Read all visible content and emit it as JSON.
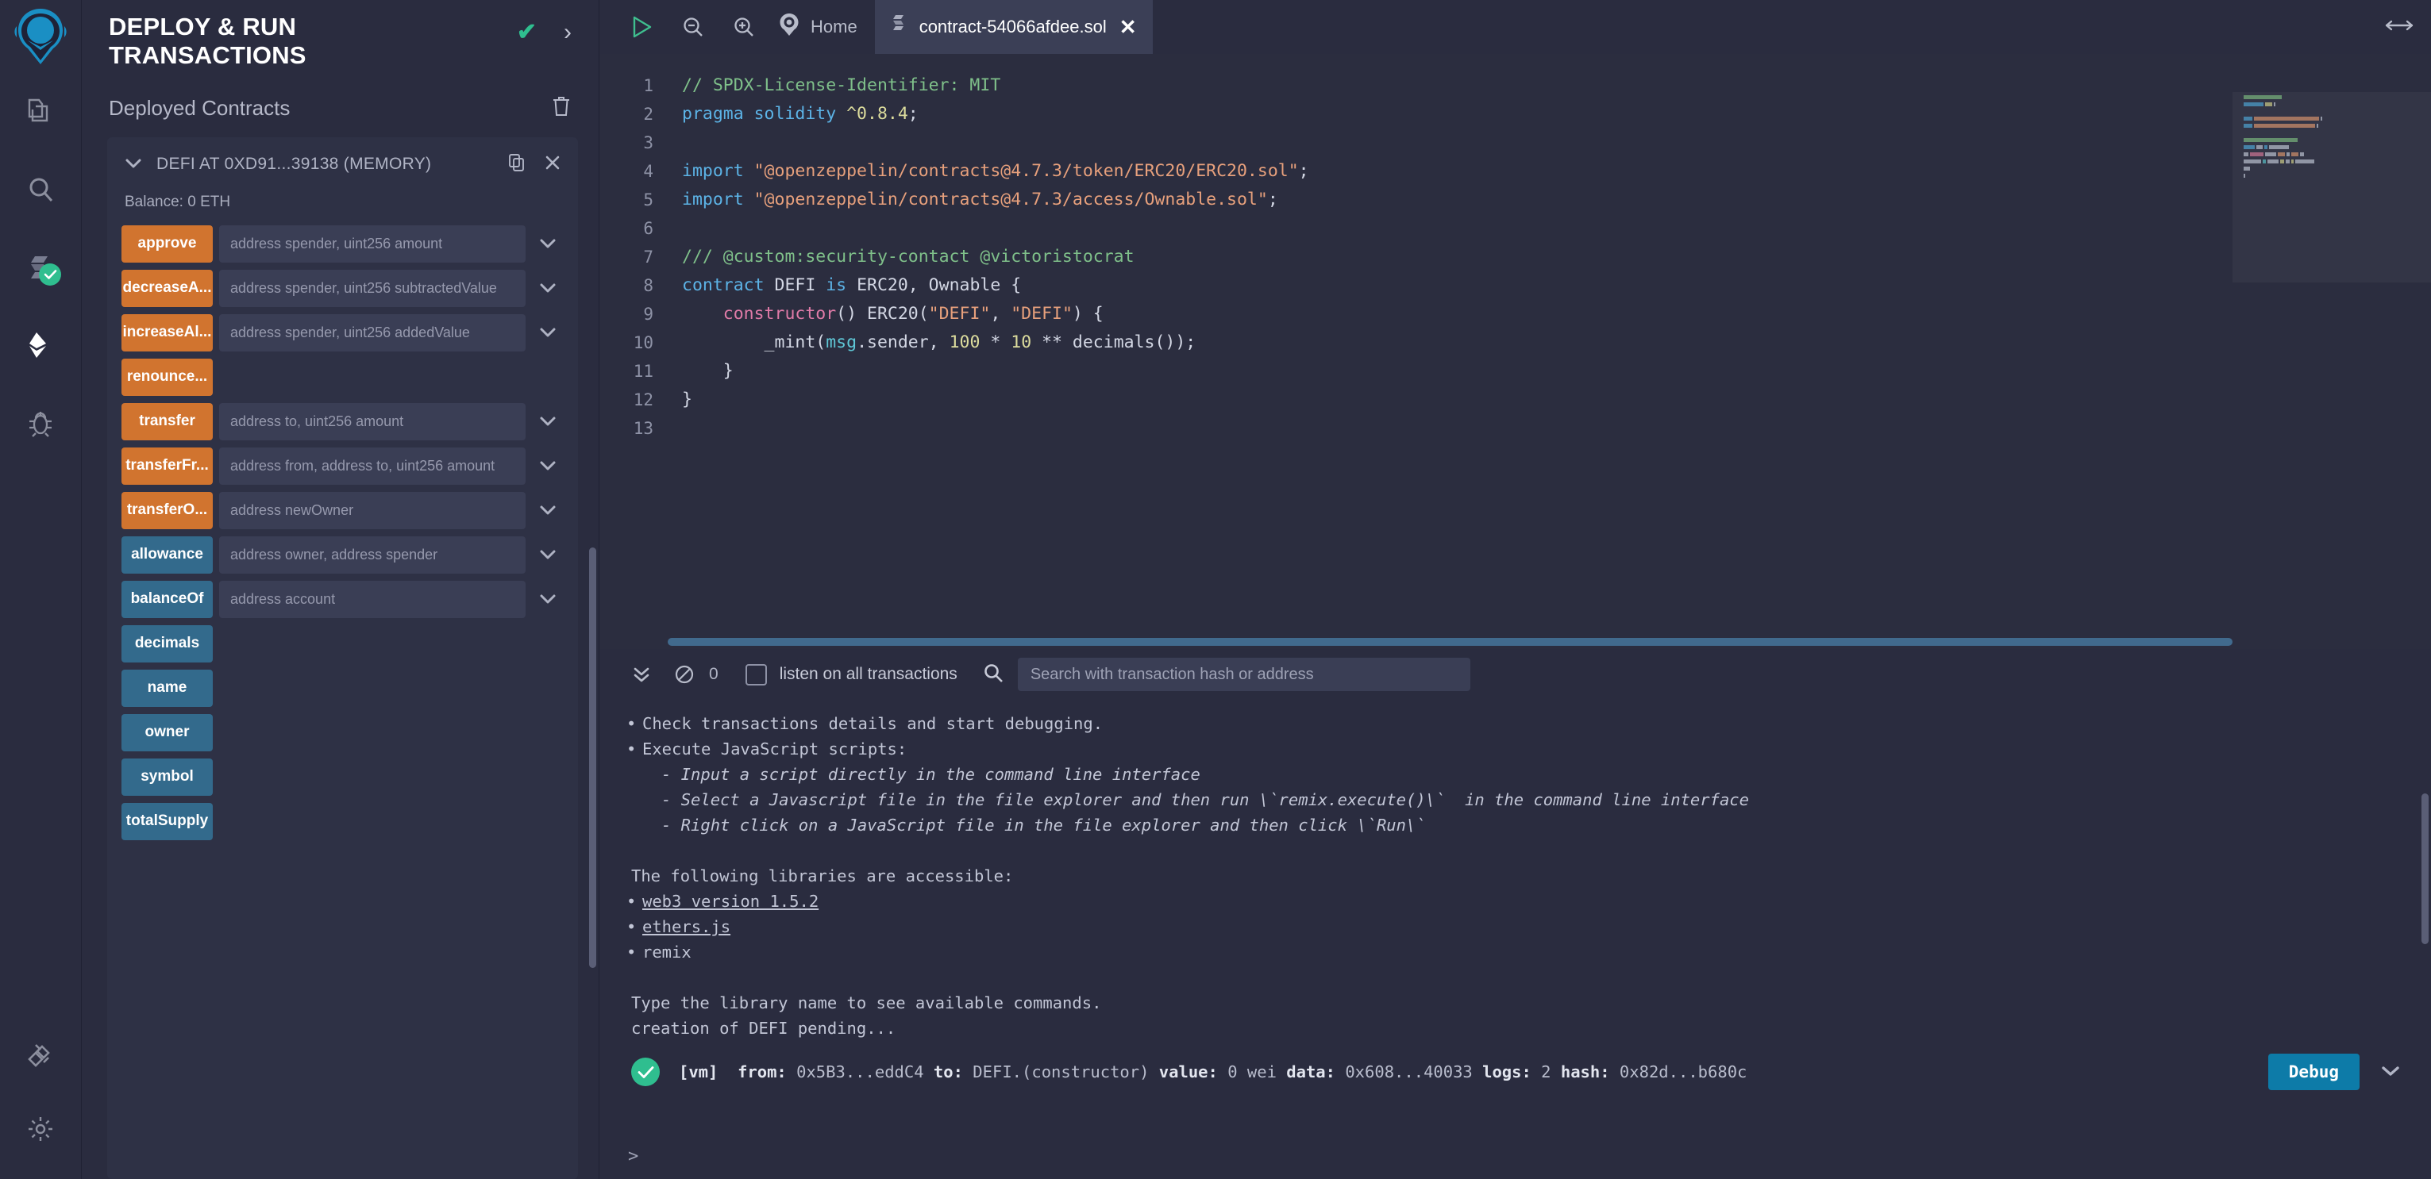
{
  "rail": {
    "logo_name": "remix-logo",
    "items": [
      {
        "name": "file-explorer-icon",
        "title": "File explorers"
      },
      {
        "name": "search-icon",
        "title": "Search in files"
      },
      {
        "name": "solidity-compiler-icon",
        "title": "Solidity compiler",
        "badge": "check"
      },
      {
        "name": "deploy-run-icon",
        "title": "Deploy & run transactions",
        "active": true
      },
      {
        "name": "debugger-icon",
        "title": "Debugger"
      }
    ],
    "bottom": [
      {
        "name": "plugin-manager-icon",
        "title": "Plugin manager"
      },
      {
        "name": "settings-gear-icon",
        "title": "Settings"
      }
    ]
  },
  "panel": {
    "title": "DEPLOY & RUN TRANSACTIONS",
    "header_check": "✔",
    "header_chevron": "›",
    "section_title": "Deployed Contracts",
    "trash_icon": "trash-icon",
    "contract": {
      "caret": "⌄",
      "name": "DEFI AT 0XD91...39138 (MEMORY)",
      "copy_icon": "copy-icon",
      "close_icon": "close-icon",
      "balance": "Balance: 0 ETH"
    },
    "functions": [
      {
        "label": "approve",
        "kind": "write",
        "placeholder": "address spender, uint256 amount",
        "caret": true
      },
      {
        "label": "decreaseA...",
        "kind": "write",
        "placeholder": "address spender, uint256 subtractedValue",
        "caret": true
      },
      {
        "label": "increaseAl...",
        "kind": "write",
        "placeholder": "address spender, uint256 addedValue",
        "caret": true
      },
      {
        "label": "renounce...",
        "kind": "write",
        "placeholder": "",
        "caret": false
      },
      {
        "label": "transfer",
        "kind": "write",
        "placeholder": "address to, uint256 amount",
        "caret": true
      },
      {
        "label": "transferFr...",
        "kind": "write",
        "placeholder": "address from, address to, uint256 amount",
        "caret": true
      },
      {
        "label": "transferO...",
        "kind": "write",
        "placeholder": "address newOwner",
        "caret": true
      },
      {
        "label": "allowance",
        "kind": "read",
        "placeholder": "address owner, address spender",
        "caret": true
      },
      {
        "label": "balanceOf",
        "kind": "read",
        "placeholder": "address account",
        "caret": true
      },
      {
        "label": "decimals",
        "kind": "read",
        "placeholder": "",
        "caret": false
      },
      {
        "label": "name",
        "kind": "read",
        "placeholder": "",
        "caret": false
      },
      {
        "label": "owner",
        "kind": "read",
        "placeholder": "",
        "caret": false
      },
      {
        "label": "symbol",
        "kind": "read",
        "placeholder": "",
        "caret": false
      },
      {
        "label": "totalSupply",
        "kind": "read",
        "placeholder": "",
        "caret": false
      }
    ]
  },
  "tabbar": {
    "run_icon": "run-play-icon",
    "zoom_out_icon": "zoom-out-icon",
    "zoom_in_icon": "zoom-in-icon",
    "home_label": "Home",
    "home_icon": "remix-home-icon",
    "file_tab": {
      "icon": "solidity-file-icon",
      "label": "contract-54066afdee.sol",
      "close": "✕"
    },
    "resize_icon": "horizontal-resize-icon"
  },
  "editor": {
    "lines": [
      {
        "n": 1,
        "tokens": [
          {
            "t": "// SPDX-License-Identifier: MIT",
            "c": "com"
          }
        ]
      },
      {
        "n": 2,
        "tokens": [
          {
            "t": "pragma solidity ",
            "c": "key"
          },
          {
            "t": "^0.8.4",
            "c": "num"
          },
          {
            "t": ";",
            "c": "pun"
          }
        ]
      },
      {
        "n": 3,
        "tokens": []
      },
      {
        "n": 4,
        "tokens": [
          {
            "t": "import ",
            "c": "key"
          },
          {
            "t": "\"@openzeppelin/contracts@4.7.3/token/ERC20/ERC20.sol\"",
            "c": "str"
          },
          {
            "t": ";",
            "c": "pun"
          }
        ]
      },
      {
        "n": 5,
        "tokens": [
          {
            "t": "import ",
            "c": "key"
          },
          {
            "t": "\"@openzeppelin/contracts@4.7.3/access/Ownable.sol\"",
            "c": "str"
          },
          {
            "t": ";",
            "c": "pun"
          }
        ]
      },
      {
        "n": 6,
        "tokens": []
      },
      {
        "n": 7,
        "tokens": [
          {
            "t": "/// @custom:security-contact @victoristocrat",
            "c": "com"
          }
        ]
      },
      {
        "n": 8,
        "tokens": [
          {
            "t": "contract ",
            "c": "key"
          },
          {
            "t": "DEFI ",
            "c": "id"
          },
          {
            "t": "is ",
            "c": "key"
          },
          {
            "t": "ERC20, Ownable {",
            "c": "id"
          }
        ]
      },
      {
        "n": 9,
        "tokens": [
          {
            "t": "    ",
            "c": "pun"
          },
          {
            "t": "constructor",
            "c": "fn"
          },
          {
            "t": "() ERC20(",
            "c": "id"
          },
          {
            "t": "\"DEFI\"",
            "c": "str"
          },
          {
            "t": ", ",
            "c": "id"
          },
          {
            "t": "\"DEFI\"",
            "c": "str"
          },
          {
            "t": ") {",
            "c": "id"
          }
        ]
      },
      {
        "n": 10,
        "tokens": [
          {
            "t": "        _mint(",
            "c": "id"
          },
          {
            "t": "msg",
            "c": "var"
          },
          {
            "t": ".sender, ",
            "c": "id"
          },
          {
            "t": "100",
            "c": "num"
          },
          {
            "t": " * ",
            "c": "id"
          },
          {
            "t": "10",
            "c": "num"
          },
          {
            "t": " ** decimals());",
            "c": "id"
          }
        ]
      },
      {
        "n": 11,
        "tokens": [
          {
            "t": "    }",
            "c": "id"
          }
        ]
      },
      {
        "n": 12,
        "tokens": [
          {
            "t": "}",
            "c": "id"
          }
        ]
      },
      {
        "n": 13,
        "tokens": []
      }
    ]
  },
  "terminal": {
    "collapse_icon": "double-chevron-down-icon",
    "clear_icon": "no-entry-clear-icon",
    "count": "0",
    "listen_label": "listen on all transactions",
    "listen_checked": false,
    "search_icon": "search-icon",
    "search_placeholder": "Search with transaction hash or address",
    "log_lines": [
      {
        "style": "bullet",
        "text": "Check transactions details and start debugging."
      },
      {
        "style": "bullet",
        "text": "Execute JavaScript scripts:"
      },
      {
        "style": "indent ital",
        "text": "- Input a script directly in the command line interface"
      },
      {
        "style": "indent ital",
        "text": "- Select a Javascript file in the file explorer and then run \\`remix.execute()\\`  in the command line interface"
      },
      {
        "style": "indent ital",
        "text": "- Right click on a JavaScript file in the file explorer and then click \\`Run\\`"
      },
      {
        "style": "blank",
        "text": ""
      },
      {
        "style": "plain",
        "text": "The following libraries are accessible:"
      },
      {
        "style": "bullet link",
        "text": "web3 version 1.5.2"
      },
      {
        "style": "bullet link",
        "text": "ethers.js"
      },
      {
        "style": "bullet",
        "text": "remix"
      },
      {
        "style": "blank",
        "text": ""
      },
      {
        "style": "plain",
        "text": "Type the library name to see available commands."
      },
      {
        "style": "plain",
        "text": "creation of DEFI pending..."
      }
    ],
    "transaction": {
      "status_icon": "success-check-icon",
      "vm": "[vm]",
      "from_label": "from:",
      "from_value": "0x5B3...eddC4",
      "to_label": "to:",
      "to_value": "DEFI.(constructor)",
      "value_label": "value:",
      "value_value": "0 wei",
      "data_label": "data:",
      "data_value": "0x608...40033",
      "logs_label": "logs:",
      "logs_value": "2",
      "hash_label": "hash:",
      "hash_value": "0x82d...b680c",
      "debug_label": "Debug",
      "expand_icon": "chevron-down-icon"
    },
    "prompt": ">"
  },
  "colors": {
    "write_button": "#d1742f",
    "read_button": "#336a8c",
    "debug_button": "#0d7ba8",
    "success": "#2fbe8f",
    "panel_bg": "#2a2c3f",
    "card_bg": "#2e3145"
  }
}
